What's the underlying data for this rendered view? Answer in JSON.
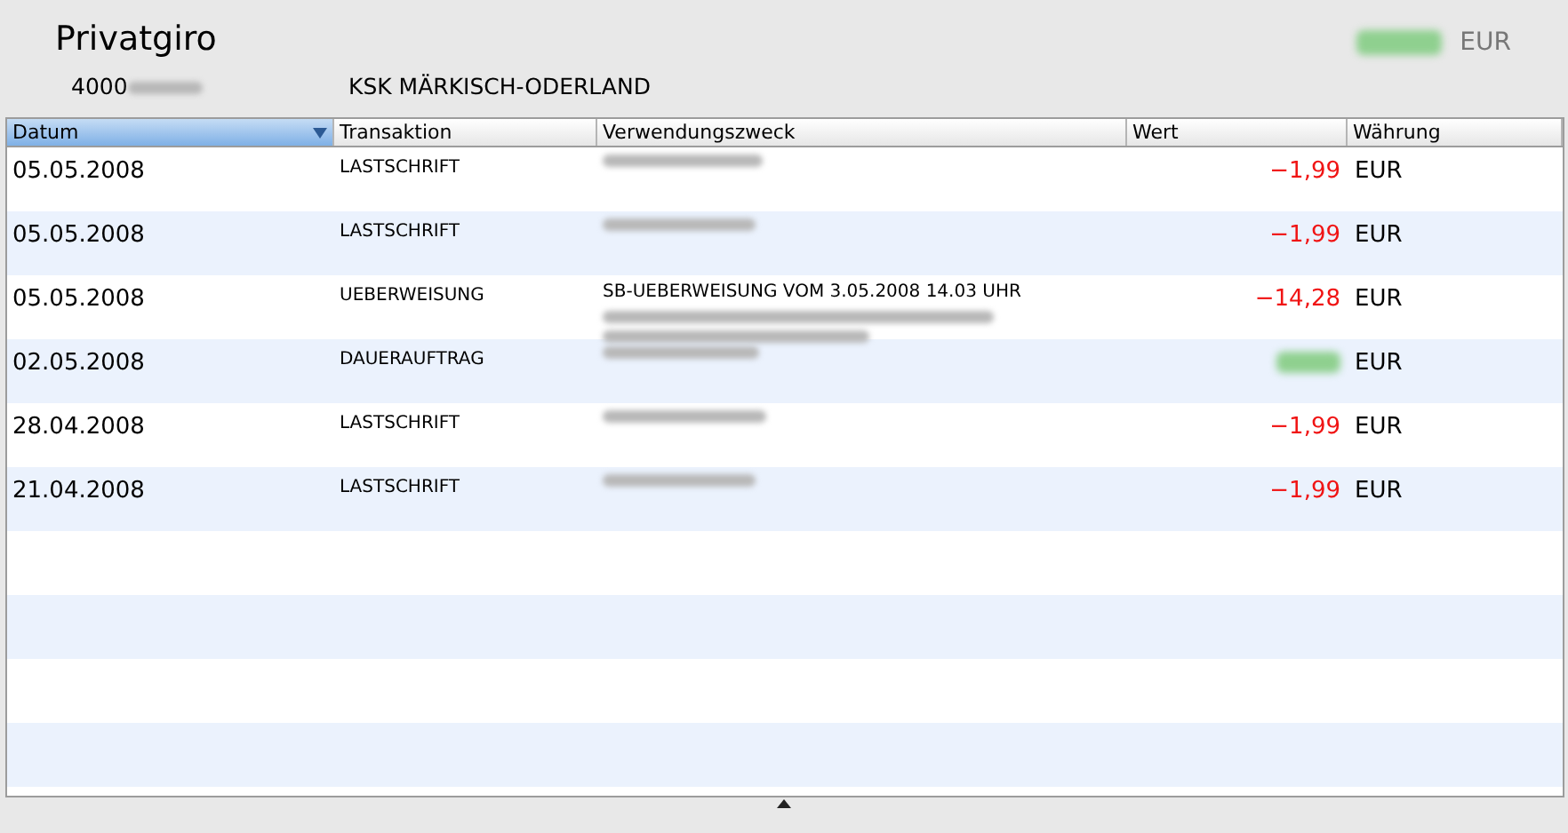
{
  "account": {
    "name": "Privatgiro",
    "number_visible": "4000",
    "number_blurred": true,
    "bank": "KSK MÄRKISCH-ODERLAND",
    "balance_blurred": true,
    "currency": "EUR"
  },
  "table": {
    "columns": [
      {
        "label": "Datum",
        "selected": true,
        "sort_descending": true
      },
      {
        "label": "Transaktion",
        "selected": false
      },
      {
        "label": "Verwendungszweck",
        "selected": false
      },
      {
        "label": "Wert",
        "selected": false
      },
      {
        "label": "Währung",
        "selected": false
      }
    ],
    "rows": [
      {
        "date": "05.05.2008",
        "type": "LASTSCHRIFT",
        "purpose_blurred": true,
        "amount": "−1,99",
        "color": "#f01414",
        "currency": "EUR"
      },
      {
        "date": "05.05.2008",
        "type": "LASTSCHRIFT",
        "purpose_blurred": true,
        "amount": "−1,99",
        "color": "#f01414",
        "currency": "EUR"
      },
      {
        "date": "05.05.2008",
        "type": "UEBERWEISUNG",
        "purpose": "SB-UEBERWEISUNG VOM 3.05.2008 14.03 UHR",
        "purpose_blurred": true,
        "amount": "−14,28",
        "color": "#f01414",
        "currency": "EUR"
      },
      {
        "date": "02.05.2008",
        "type": "DAUERAUFTRAG",
        "purpose_blurred": true,
        "amount_blurred": true,
        "color": "#8fd08f",
        "currency": "EUR"
      },
      {
        "date": "28.04.2008",
        "type": "LASTSCHRIFT",
        "purpose_blurred": true,
        "amount": "−1,99",
        "color": "#f01414",
        "currency": "EUR"
      },
      {
        "date": "21.04.2008",
        "type": "LASTSCHRIFT",
        "purpose_blurred": true,
        "amount": "−1,99",
        "color": "#f01414",
        "currency": "EUR"
      }
    ]
  }
}
